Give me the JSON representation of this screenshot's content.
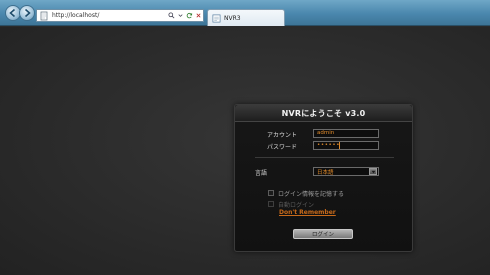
{
  "browser": {
    "address": "http://localhost/",
    "tab_title": "NVR3"
  },
  "login": {
    "title": "NVRにようこそ  v3.0",
    "account_label": "アカウント",
    "account_value": "admin",
    "password_label": "パスワード",
    "password_value": "••••••",
    "language_label": "言語",
    "language_value": "日本語",
    "remember_label": "ログイン情報を記憶する",
    "auto_login_label": "自動ログイン",
    "dont_remember_link": "Don't Remember",
    "login_button": "ログイン"
  },
  "colors": {
    "accent": "#e08a2a",
    "link": "#c86a1a",
    "panel_bg": "#111111",
    "page_bg": "#2b2b2b"
  },
  "icons": {
    "back": "back-arrow-icon",
    "forward": "forward-arrow-icon",
    "page": "page-icon",
    "search": "search-icon",
    "refresh": "refresh-icon",
    "stop": "stop-icon",
    "tab": "ie-tab-icon",
    "dropdown": "chevron-down-icon"
  }
}
